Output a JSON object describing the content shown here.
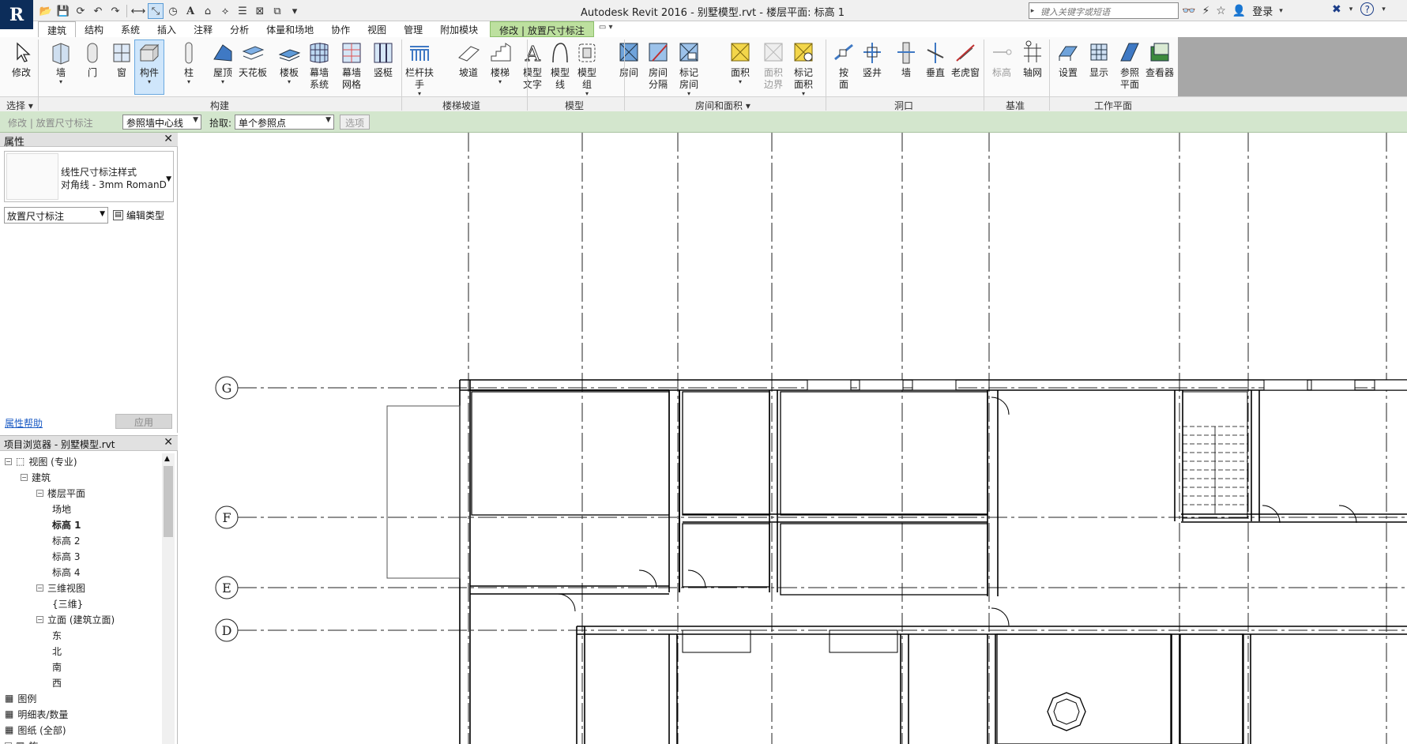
{
  "app": {
    "logo": "R",
    "title": "Autodesk Revit 2016 -     别墅模型.rvt - 楼层平面: 标高 1",
    "search_placeholder": "键入关键字或短语",
    "login": "登录"
  },
  "tabs": [
    {
      "label": "建筑",
      "active": true
    },
    {
      "label": "结构"
    },
    {
      "label": "系统"
    },
    {
      "label": "插入"
    },
    {
      "label": "注释"
    },
    {
      "label": "分析"
    },
    {
      "label": "体量和场地"
    },
    {
      "label": "协作"
    },
    {
      "label": "视图"
    },
    {
      "label": "管理"
    },
    {
      "label": "附加模块"
    },
    {
      "label": "修改 | 放置尺寸标注",
      "contextual": true
    }
  ],
  "ribbon": {
    "buttons": [
      {
        "label": "修改",
        "icon": "cursor-arrow-icon"
      },
      {
        "label": "墙",
        "icon": "wall-icon",
        "dropdown": true
      },
      {
        "label": "门",
        "icon": "door-icon"
      },
      {
        "label": "窗",
        "icon": "window-icon"
      },
      {
        "label": "构件",
        "icon": "component-icon",
        "dropdown": true,
        "selected": true
      },
      {
        "label": "柱",
        "icon": "column-icon",
        "dropdown": true
      },
      {
        "label": "屋顶",
        "icon": "roof-icon",
        "dropdown": true
      },
      {
        "label": "天花板",
        "icon": "ceiling-icon"
      },
      {
        "label": "楼板",
        "icon": "floor-icon",
        "dropdown": true
      },
      {
        "label": "幕墙\n系统",
        "icon": "curtain-system-icon"
      },
      {
        "label": "幕墙\n网格",
        "icon": "curtain-grid-icon"
      },
      {
        "label": "竖梃",
        "icon": "mullion-icon"
      },
      {
        "label": "栏杆扶手",
        "icon": "railing-icon",
        "dropdown": true
      },
      {
        "label": "坡道",
        "icon": "ramp-icon"
      },
      {
        "label": "楼梯",
        "icon": "stair-icon",
        "dropdown": true
      },
      {
        "label": "模型\n文字",
        "icon": "model-text-icon"
      },
      {
        "label": "模型\n线",
        "icon": "model-line-icon"
      },
      {
        "label": "模型\n组",
        "icon": "model-group-icon",
        "dropdown": true
      },
      {
        "label": "房间",
        "icon": "room-icon"
      },
      {
        "label": "房间\n分隔",
        "icon": "room-separator-icon"
      },
      {
        "label": "标记\n房间",
        "icon": "tag-room-icon",
        "dropdown": true
      },
      {
        "label": "面积",
        "icon": "area-icon",
        "dropdown": true
      },
      {
        "label": "面积\n边界",
        "icon": "area-boundary-icon",
        "disabled": true
      },
      {
        "label": "标记\n面积",
        "icon": "tag-area-icon",
        "dropdown": true
      },
      {
        "label": "按\n面",
        "icon": "by-face-icon"
      },
      {
        "label": "竖井",
        "icon": "shaft-icon"
      },
      {
        "label": "墙",
        "icon": "wall-opening-icon"
      },
      {
        "label": "垂直",
        "icon": "vertical-opening-icon"
      },
      {
        "label": "老虎窗",
        "icon": "dormer-icon"
      },
      {
        "label": "标高",
        "icon": "level-icon",
        "disabled": true
      },
      {
        "label": "轴网",
        "icon": "grid-icon"
      },
      {
        "label": "设置",
        "icon": "set-workplane-icon"
      },
      {
        "label": "显示",
        "icon": "show-workplane-icon"
      },
      {
        "label": "参照\n平面",
        "icon": "ref-plane-icon"
      },
      {
        "label": "查看器",
        "icon": "viewer-icon"
      }
    ],
    "panels": [
      {
        "label": "选择 ▾"
      },
      {
        "label": "构建"
      },
      {
        "label": "楼梯坡道"
      },
      {
        "label": "模型"
      },
      {
        "label": "房间和面积 ▾"
      },
      {
        "label": "洞口"
      },
      {
        "label": "基准"
      },
      {
        "label": "工作平面"
      }
    ]
  },
  "options_bar": {
    "context": "修改 | 放置尺寸标注",
    "reference": "参照墙中心线",
    "pick_label": "拾取:",
    "pick_value": "单个参照点",
    "options_button": "选项"
  },
  "properties": {
    "title": "属性",
    "type_line1": "线性尺寸标注样式",
    "type_line2": "对角线 - 3mm RomanD",
    "instance": "放置尺寸标注",
    "edit_type": "编辑类型",
    "help": "属性帮助",
    "apply": "应用"
  },
  "browser": {
    "title": "项目浏览器 - 别墅模型.rvt",
    "items": [
      {
        "label": "视图 (专业)"
      },
      {
        "label": "建筑"
      },
      {
        "label": "楼层平面"
      },
      {
        "label": "场地"
      },
      {
        "label": "标高 1",
        "bold": true
      },
      {
        "label": "标高 2"
      },
      {
        "label": "标高 3"
      },
      {
        "label": "标高 4"
      },
      {
        "label": "三维视图"
      },
      {
        "label": "{三维}"
      },
      {
        "label": "立面 (建筑立面)"
      },
      {
        "label": "东"
      },
      {
        "label": "北"
      },
      {
        "label": "南"
      },
      {
        "label": "西"
      },
      {
        "label": "图例"
      },
      {
        "label": "明细表/数量"
      },
      {
        "label": "图纸 (全部)"
      },
      {
        "label": "族"
      }
    ]
  },
  "canvas": {
    "grid_labels": [
      "G",
      "F",
      "E",
      "D"
    ]
  },
  "colors": {
    "ribbon_ctx_tab": "#bde09f",
    "options_bar": "#d3e6cd",
    "logo_bg": "#0c2d5a",
    "icon_blue": "#3f79c4",
    "icon_yellow": "#f3d64a"
  }
}
